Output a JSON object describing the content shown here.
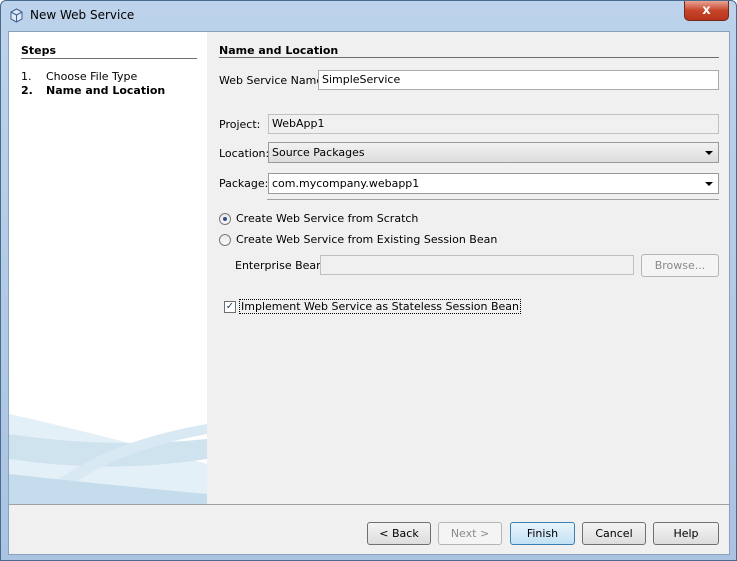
{
  "window": {
    "title": "New Web Service",
    "close_glyph": "x"
  },
  "steps": {
    "title": "Steps",
    "items": [
      {
        "num": "1.",
        "label": "Choose File Type",
        "active": false
      },
      {
        "num": "2.",
        "label": "Name and Location",
        "active": true
      }
    ]
  },
  "main": {
    "title": "Name and Location",
    "service_name_label": "Web Service Name:",
    "service_name_value": "SimpleService",
    "project_label": "Project:",
    "project_value": "WebApp1",
    "location_label": "Location:",
    "location_value": "Source Packages",
    "package_label": "Package:",
    "package_value": "com.mycompany.webapp1",
    "radio_scratch_label": "Create Web Service from Scratch",
    "radio_scratch_selected": true,
    "radio_bean_label": "Create Web Service from Existing Session Bean",
    "enterprise_bean_label": "Enterprise Bean:",
    "enterprise_bean_value": "",
    "browse_label": "Browse...",
    "implement_checkbox_label": "Implement Web Service as Stateless Session Bean",
    "implement_checked": true
  },
  "buttons": {
    "back": "< Back",
    "next": "Next >",
    "finish": "Finish",
    "cancel": "Cancel",
    "help": "Help"
  },
  "colors": {
    "title_bar": "#bcd3eb",
    "close": "#c7452b",
    "panel": "#f0f0f0"
  }
}
